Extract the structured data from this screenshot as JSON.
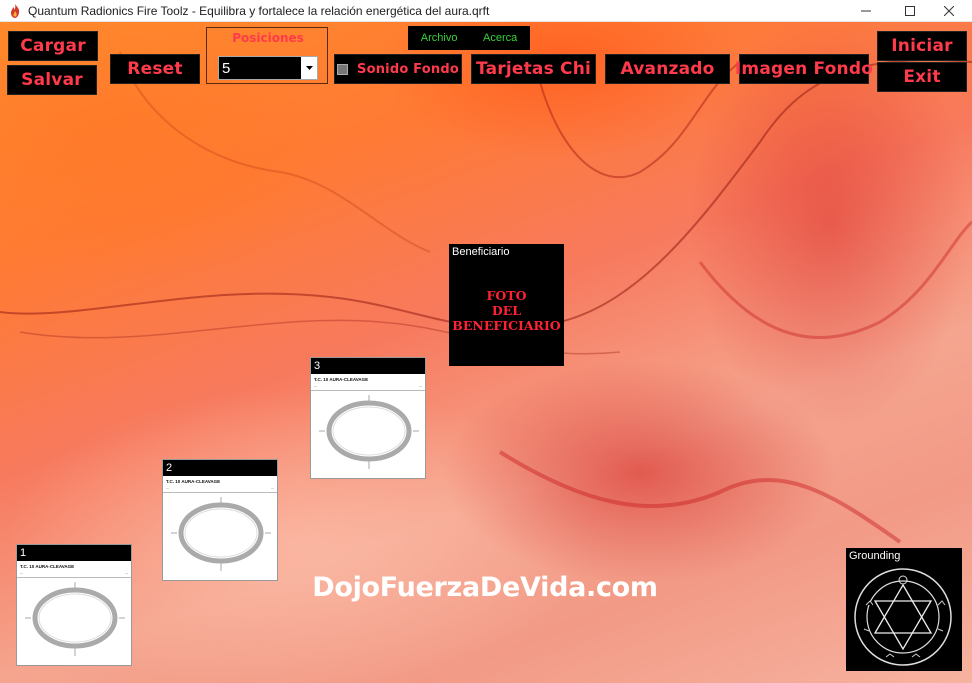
{
  "window": {
    "title": "Quantum Radionics Fire Toolz - Equilibra y fortalece la relación energética del aura.qrft",
    "controls": [
      "minimize-icon",
      "maximize-icon",
      "close-icon"
    ]
  },
  "menu": {
    "archivo": "Archivo",
    "acerca": "Acerca"
  },
  "toolbar": {
    "cargar": "Cargar",
    "salvar": "Salvar",
    "reset": "Reset",
    "posiciones_label": "Posiciones",
    "posiciones_value": "5",
    "sonido_fondo": "Sonido Fondo",
    "sonido_fondo_checked": false,
    "tarjetas_chi": "Tarjetas Chi",
    "avanzado": "Avanzado",
    "imagen_fondo": "Imagen Fondo",
    "iniciar": "Iniciar",
    "exit": "Exit"
  },
  "cards": [
    {
      "number": "1",
      "title": "T.C. 10  AURA-CLEAVAGE"
    },
    {
      "number": "2",
      "title": "T.C. 10  AURA-CLEAVAGE"
    },
    {
      "number": "3",
      "title": "T.C. 10  AURA-CLEAVAGE"
    }
  ],
  "beneficiario": {
    "label": "Beneficiario",
    "photo_line1": "FOTO",
    "photo_line2": "DEL",
    "photo_line3": "BENEFICIARIO"
  },
  "grounding": {
    "label": "Grounding"
  },
  "watermark": "DojoFuerzaDeVida.com",
  "colors": {
    "button_bg": "#000000",
    "button_text": "#ff3a4a",
    "menu_text": "#39d039"
  }
}
